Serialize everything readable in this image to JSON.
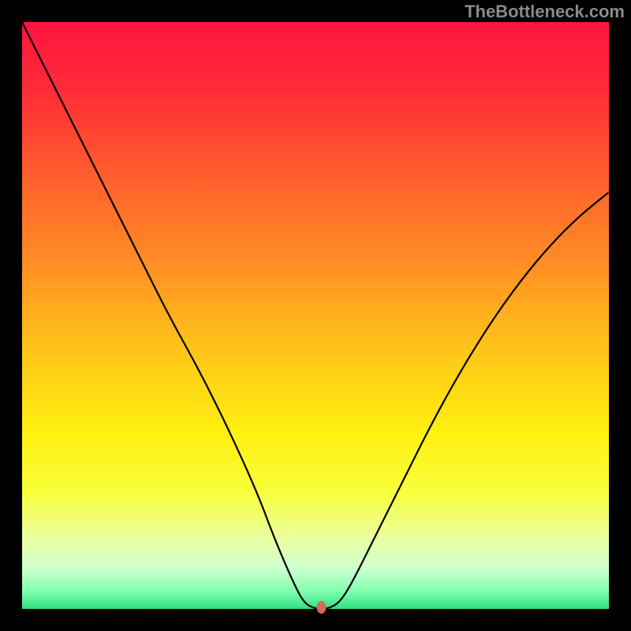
{
  "watermark": "TheBottleneck.com",
  "chart_data": {
    "type": "line",
    "title": "",
    "xlabel": "",
    "ylabel": "",
    "xlim": [
      0,
      100
    ],
    "ylim": [
      0,
      100
    ],
    "background": {
      "type": "vertical_gradient",
      "stops": [
        {
          "offset": 0.0,
          "color": "#ff143e"
        },
        {
          "offset": 0.12,
          "color": "#ff2d37"
        },
        {
          "offset": 0.25,
          "color": "#ff5a2d"
        },
        {
          "offset": 0.4,
          "color": "#ff8a25"
        },
        {
          "offset": 0.55,
          "color": "#ffc21a"
        },
        {
          "offset": 0.7,
          "color": "#fff010"
        },
        {
          "offset": 0.8,
          "color": "#f9ff3a"
        },
        {
          "offset": 0.88,
          "color": "#e9ffa0"
        },
        {
          "offset": 0.93,
          "color": "#cfffcf"
        },
        {
          "offset": 0.97,
          "color": "#80ffb0"
        },
        {
          "offset": 1.0,
          "color": "#30e080"
        }
      ]
    },
    "border_color": "#000000",
    "series": [
      {
        "name": "bottleneck-curve",
        "color": "#000000",
        "stroke_width": 2.2,
        "x": [
          0,
          5,
          10,
          15,
          20,
          25,
          30,
          35,
          40,
          43,
          46,
          48,
          50,
          52,
          54,
          56,
          60,
          65,
          70,
          75,
          80,
          85,
          90,
          95,
          100
        ],
        "values": [
          100,
          90,
          80,
          70,
          60,
          50,
          41,
          31,
          20,
          12,
          5,
          1,
          0,
          0,
          1,
          4,
          12,
          22,
          32,
          41,
          49,
          56,
          62,
          67,
          71
        ]
      }
    ],
    "marker": {
      "name": "optimal-point",
      "x": 51,
      "y": 0,
      "color": "#d46a5a",
      "rx": 6,
      "ry": 8
    }
  }
}
